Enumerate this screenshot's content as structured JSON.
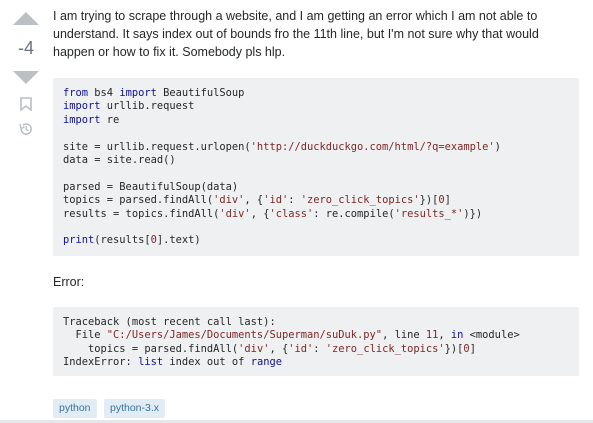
{
  "vote": {
    "count": "-4"
  },
  "question": {
    "body": "I am trying to scrape through a website, and I am getting an error which I am not able to understand. It says index out of bounds fro the 11th line, but I'm not sure why that would happen or how to fix it. Somebody pls hlp."
  },
  "code_lines": [
    "from bs4 import BeautifulSoup",
    "import urllib.request",
    "import re",
    "",
    "site = urllib.request.urlopen('http://duckduckgo.com/html/?q=example')",
    "data = site.read()",
    "",
    "parsed = BeautifulSoup(data)",
    "topics = parsed.findAll('div', {'id': 'zero_click_topics'})[0]",
    "results = topics.findAll('div', {'class': re.compile('results_*')})",
    "",
    "print(results[0].text)"
  ],
  "error_label": "Error:",
  "traceback_lines": [
    "Traceback (most recent call last):",
    "  File \"C:/Users/James/Documents/Superman/suDuk.py\", line 11, in <module>",
    "    topics = parsed.findAll('div', {'id': 'zero_click_topics'})[0]",
    "IndexError: list index out of range"
  ],
  "tags": [
    "python",
    "python-3.x"
  ],
  "icons": {
    "upvote": "arrow-up-icon",
    "downvote": "arrow-down-icon",
    "bookmark": "bookmark-icon",
    "history": "history-icon"
  },
  "colors": {
    "code_background": "#eff0f1",
    "tag_background": "#e1ecf4",
    "tag_text": "#39739d",
    "keyword": "#101094",
    "string": "#7d2727"
  }
}
